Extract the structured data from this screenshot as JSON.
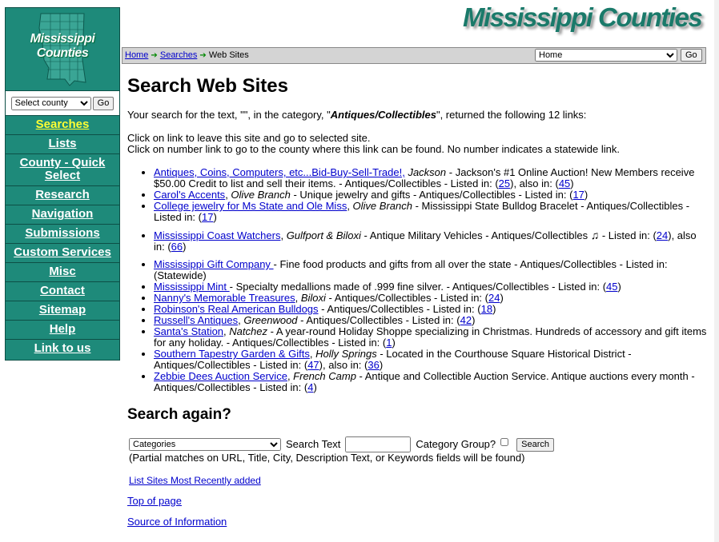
{
  "site": {
    "title": "Mississippi Counties",
    "logo_line1": "Mississippi",
    "logo_line2": "Counties"
  },
  "county_select": {
    "selected": "Select county",
    "go": "Go"
  },
  "nav": [
    {
      "label": "Searches",
      "active": true
    },
    {
      "label": "Lists"
    },
    {
      "label": "County - Quick Select"
    },
    {
      "label": "Research"
    },
    {
      "label": "Navigation"
    },
    {
      "label": "Submissions"
    },
    {
      "label": "Custom Services"
    },
    {
      "label": "Misc"
    },
    {
      "label": "Contact"
    },
    {
      "label": "Sitemap"
    },
    {
      "label": "Help"
    },
    {
      "label": "Link to us"
    }
  ],
  "breadcrumb": {
    "home": "Home",
    "searches": "Searches",
    "current": "Web Sites"
  },
  "jump": {
    "selected": "Home",
    "go": "Go"
  },
  "page": {
    "heading": "Search Web Sites",
    "summary_pre": "Your search for the text, \"\", in the category, \"",
    "summary_category": "Antiques/Collectibles",
    "summary_post": "\", returned the following 12 links:",
    "help1": "Click on link to leave this site and go to selected site.",
    "help2": "Click on number link to go to the county where this link can be found. No number indicates a statewide link."
  },
  "results": [
    {
      "name": "Antiques, Coins, Computers, etc...Bid-Buy-Sell-Trade!,",
      "city": "Jackson",
      "desc": " - Jackson's #1 Online Auction! New Members receive $50.00 Credit to list and sell their items. - Antiques/Collectibles  - Listed in: (",
      "n1": "25",
      "mid": "), also in: (",
      "n2": "45",
      "end": ")"
    },
    {
      "name": "Carol's Accents",
      "city": "Olive Branch",
      "desc": " - Unique jewelry and gifts - Antiques/Collectibles  - Listed in: (",
      "n1": "17",
      "end": ")"
    },
    {
      "name": "College jewelry for Ms State and Ole Miss",
      "city": "Olive Branch",
      "desc": " - Mississippi State Bulldog Bracelet - Antiques/Collectibles  - Listed in: (",
      "n1": "17",
      "end": ")"
    },
    {
      "name": "Mississippi Coast Watchers",
      "city": "Gulfport & Biloxi",
      "desc": " - Antique Military Vehicles - Antiques/Collectibles ",
      "icon": "music-note-icon",
      "desc2": " - Listed in: (",
      "n1": "24",
      "mid": "), also in: (",
      "n2": "66",
      "end": ")"
    },
    {
      "name": "Mississippi Gift Company ",
      "city": "",
      "desc": " - Fine food products and gifts from all over the state - Antiques/Collectibles  - Listed in: (Statewide)"
    },
    {
      "name": "Mississippi Mint ",
      "city": "",
      "desc": " - Specialty medallions made of .999 fine silver. - Antiques/Collectibles  - Listed in: (",
      "n1": "45",
      "end": ")"
    },
    {
      "name": "Nanny's Memorable Treasures",
      "city": "Biloxi",
      "desc": " - Antiques/Collectibles  - Listed in: (",
      "n1": "24",
      "end": ")"
    },
    {
      "name": "Robinson's Real American Bulldogs",
      "city": "",
      "desc": " - Antiques/Collectibles  - Listed in: (",
      "n1": "18",
      "end": ")"
    },
    {
      "name": "Russell's Antiques",
      "city": "Greenwood",
      "desc": " - Antiques/Collectibles  - Listed in: (",
      "n1": "42",
      "end": ")"
    },
    {
      "name": "Santa's Station",
      "city": "Natchez",
      "desc": " - A year-round Holiday Shoppe specializing in Christmas. Hundreds of accessory and gift items for any holiday. - Antiques/Collectibles  - Listed in: (",
      "n1": "1",
      "end": ")"
    },
    {
      "name": "Southern Tapestry Garden & Gifts",
      "city": "Holly Springs",
      "desc": " - Located in the Courthouse Square Historical District - Antiques/Collectibles  - Listed in: (",
      "n1": "47",
      "mid": "), also in: (",
      "n2": "36",
      "end": ")"
    },
    {
      "name": "Zebbie Dees Auction Service",
      "city": "French Camp",
      "desc": " - Antique and Collectible Auction Service. Antique auctions every month - Antiques/Collectibles  - Listed in: (",
      "n1": "4",
      "end": ")"
    }
  ],
  "search_again": {
    "heading": "Search again?",
    "category_selected": "Categories",
    "text_label": "Search Text",
    "group_label": "Category Group?",
    "button": "Search",
    "note": "(Partial matches on URL, Title, City, Description Text, or Keywords fields will be found)"
  },
  "links": {
    "recent": "List Sites Most Recently added",
    "top": "Top of page",
    "source": "Source of Information"
  }
}
